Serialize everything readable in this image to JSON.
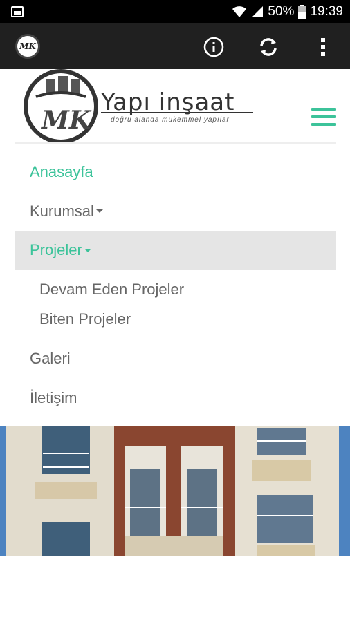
{
  "status_bar": {
    "battery_percent": "50%",
    "time": "19:39"
  },
  "app_bar": {
    "logo_text": "MK"
  },
  "brand": {
    "logo_letters": "MK",
    "title": "Yapı inşaat",
    "tagline": "doğru alanda mükemmel yapılar"
  },
  "menu": {
    "items": [
      {
        "label": "Anasayfa"
      },
      {
        "label": "Kurumsal"
      },
      {
        "label": "Projeler"
      },
      {
        "label": "Galeri"
      },
      {
        "label": "İletişim"
      }
    ],
    "submenu": [
      {
        "label": "Devam Eden Projeler"
      },
      {
        "label": "Biten Projeler"
      }
    ]
  },
  "colors": {
    "accent": "#3cc39a",
    "app_bar": "#202020",
    "status_bar": "#000000",
    "open_item_bg": "#e5e5e5"
  }
}
